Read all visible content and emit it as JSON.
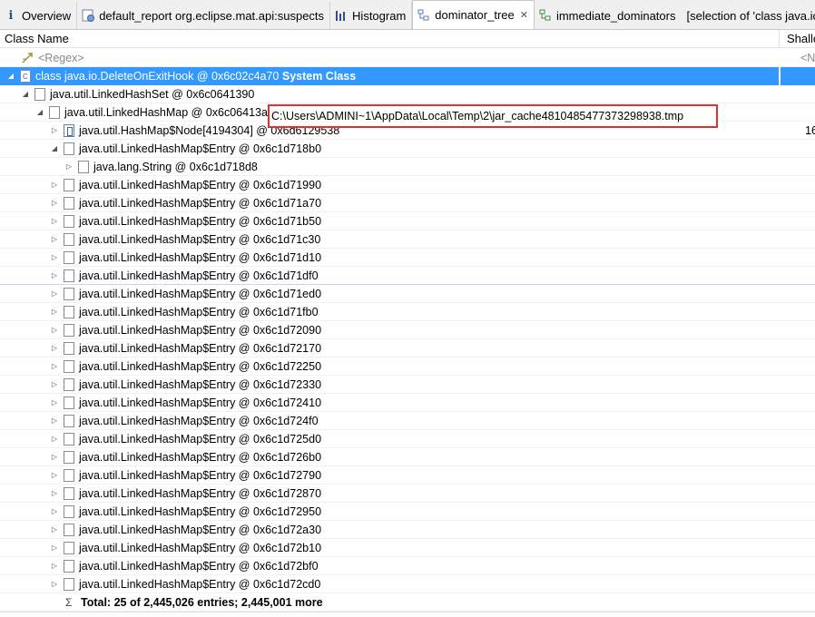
{
  "tabs": [
    {
      "label": "Overview",
      "icon": "info-icon",
      "active": false
    },
    {
      "label": "default_report  org.eclipse.mat.api:suspects",
      "icon": "report-icon",
      "active": false
    },
    {
      "label": "Histogram",
      "icon": "histogram-icon",
      "active": false
    },
    {
      "label": "dominator_tree",
      "icon": "tree-icon",
      "active": true,
      "close": "✕"
    },
    {
      "label": "immediate_dominators",
      "extra": "[selection of 'class java.io",
      "icon": "dominators-icon",
      "active": false
    }
  ],
  "columns": {
    "class_name": "Class Name",
    "shallow": "Shallo"
  },
  "regex_row": {
    "placeholder": "<Regex>",
    "shallow": "<N"
  },
  "root_row": {
    "prefix": "class java.io.DeleteOnExitHook @ 0x6c02c4a70 ",
    "bold": "System Class"
  },
  "linkedhashset_row": "java.util.LinkedHashSet @ 0x6c0641390",
  "linkedhashmap_row": "java.util.LinkedHashMap @ 0x6c06413a0",
  "node_row": {
    "label": "java.util.HashMap$Node[4194304] @ 0x6d6129538",
    "shallow": "16"
  },
  "expanded_entry": "java.util.LinkedHashMap$Entry @ 0x6c1d718b0",
  "string_row": {
    "label": "java.lang.String @ 0x6c1d718d8",
    "value": "C:\\Users\\ADMINI~1\\AppData\\Local\\Temp\\2\\jar_cache4810485477373298938.tmp"
  },
  "entries": [
    "java.util.LinkedHashMap$Entry @ 0x6c1d71990",
    "java.util.LinkedHashMap$Entry @ 0x6c1d71a70",
    "java.util.LinkedHashMap$Entry @ 0x6c1d71b50",
    "java.util.LinkedHashMap$Entry @ 0x6c1d71c30",
    "java.util.LinkedHashMap$Entry @ 0x6c1d71d10",
    "java.util.LinkedHashMap$Entry @ 0x6c1d71df0",
    "java.util.LinkedHashMap$Entry @ 0x6c1d71ed0",
    "java.util.LinkedHashMap$Entry @ 0x6c1d71fb0",
    "java.util.LinkedHashMap$Entry @ 0x6c1d72090",
    "java.util.LinkedHashMap$Entry @ 0x6c1d72170",
    "java.util.LinkedHashMap$Entry @ 0x6c1d72250",
    "java.util.LinkedHashMap$Entry @ 0x6c1d72330",
    "java.util.LinkedHashMap$Entry @ 0x6c1d72410",
    "java.util.LinkedHashMap$Entry @ 0x6c1d724f0",
    "java.util.LinkedHashMap$Entry @ 0x6c1d725d0",
    "java.util.LinkedHashMap$Entry @ 0x6c1d726b0",
    "java.util.LinkedHashMap$Entry @ 0x6c1d72790",
    "java.util.LinkedHashMap$Entry @ 0x6c1d72870",
    "java.util.LinkedHashMap$Entry @ 0x6c1d72950",
    "java.util.LinkedHashMap$Entry @ 0x6c1d72a30",
    "java.util.LinkedHashMap$Entry @ 0x6c1d72b10",
    "java.util.LinkedHashMap$Entry @ 0x6c1d72bf0",
    "java.util.LinkedHashMap$Entry @ 0x6c1d72cd0"
  ],
  "total_row": "Total: 25 of 2,445,026 entries; 2,445,001 more",
  "colors": {
    "selection": "#3399ff",
    "highlight_box": "#e03131"
  }
}
